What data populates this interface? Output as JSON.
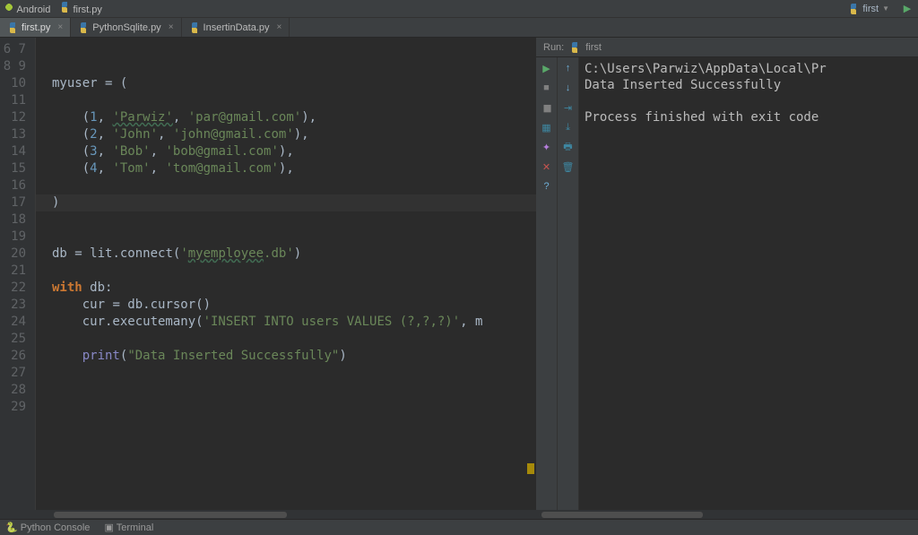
{
  "topbar": {
    "left_items": [
      "Android",
      "first.py"
    ],
    "run_config": "first"
  },
  "tabs": [
    {
      "label": "first.py",
      "active": true
    },
    {
      "label": "PythonSqlite.py",
      "active": false
    },
    {
      "label": "InsertinData.py",
      "active": false
    }
  ],
  "line_start": 6,
  "line_end": 29,
  "code": {
    "l6": {
      "a": "myuser ",
      "b": "= ",
      "c": "("
    },
    "l7": "",
    "l8": {
      "a": "    (",
      "n": "1",
      "b": ", ",
      "s1": "'Parwiz'",
      "c": ", ",
      "s2": "'par@gmail.com'",
      "d": "),"
    },
    "l9": {
      "a": "    (",
      "n": "2",
      "b": ", ",
      "s1": "'John'",
      "c": ", ",
      "s2": "'john@gmail.com'",
      "d": "),"
    },
    "l10": {
      "a": "    (",
      "n": "3",
      "b": ", ",
      "s1": "'Bob'",
      "c": ", ",
      "s2": "'bob@gmail.com'",
      "d": "),"
    },
    "l11": {
      "a": "    (",
      "n": "4",
      "b": ", ",
      "s1": "'Tom'",
      "c": ", ",
      "s2": "'tom@gmail.com'",
      "d": "),"
    },
    "l12": "",
    "l13": ")",
    "l14": "",
    "l15": "",
    "l16": {
      "a": "db ",
      "b": "= ",
      "c": "lit.connect(",
      "s": "'",
      "su": "myemployee",
      "s2": ".db'",
      "d": ")"
    },
    "l17": "",
    "l18": {
      "kw": "with ",
      "a": "db:"
    },
    "l19": {
      "a": "    cur ",
      "b": "= ",
      "c": "db.cursor()"
    },
    "l20": {
      "a": "    cur.executemany(",
      "s": "'INSERT INTO users VALUES (?,?,?)'",
      "b": ", m"
    },
    "l21": "",
    "l22": {
      "a": "    ",
      "bi": "print",
      "b": "(",
      "s": "\"Data Inserted Successfully\"",
      "c": ")"
    }
  },
  "run": {
    "header_label": "Run:",
    "header_config": "first",
    "output": [
      "C:\\Users\\Parwiz\\AppData\\Local\\Pr",
      "Data Inserted Successfully",
      "",
      "Process finished with exit code "
    ]
  },
  "bottom": {
    "python_console": "Python Console",
    "terminal": "Terminal"
  }
}
